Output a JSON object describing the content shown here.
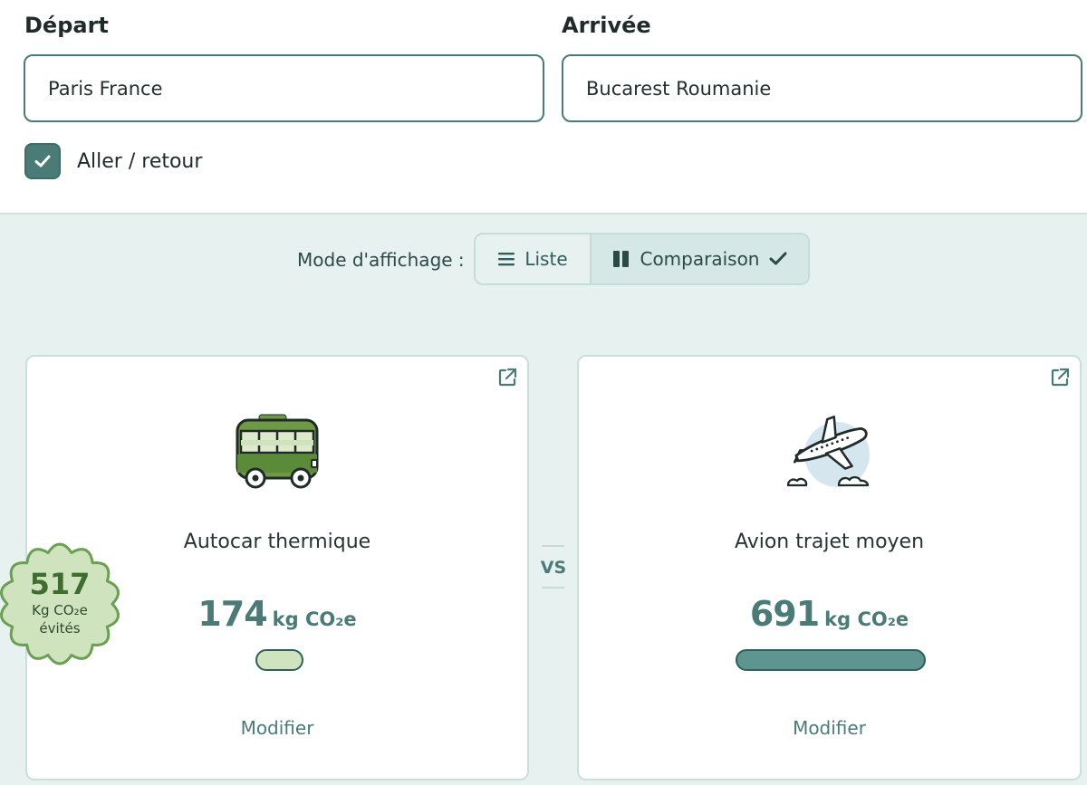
{
  "form": {
    "departure_label": "Départ",
    "departure_value": "Paris France",
    "arrival_label": "Arrivée",
    "arrival_value": "Bucarest Roumanie",
    "round_trip_label": "Aller / retour",
    "round_trip_checked": true
  },
  "display_mode": {
    "label": "Mode d'affichage :",
    "options": [
      {
        "label": "Liste",
        "icon": "list-icon",
        "selected": false
      },
      {
        "label": "Comparaison",
        "icon": "columns-icon",
        "selected": true
      }
    ]
  },
  "savings_badge": {
    "value": "517",
    "unit_line": "Kg CO₂e",
    "caption": "évités"
  },
  "vs_label": "VS",
  "cards": [
    {
      "name": "Autocar thermique",
      "icon": "bus-icon",
      "value": "174",
      "unit": "kg CO₂e",
      "bar_fraction": 0.25,
      "bar_color": "#cfe3bf",
      "action": "Modifier"
    },
    {
      "name": "Avion trajet moyen",
      "icon": "airplane-icon",
      "value": "691",
      "unit": "kg CO₂e",
      "bar_fraction": 1.0,
      "bar_color": "#5e9590",
      "action": "Modifier"
    }
  ],
  "colors": {
    "accent": "#4a7b77",
    "panel_background": "#e6f1f0",
    "badge_green": "#cfe3bf"
  }
}
